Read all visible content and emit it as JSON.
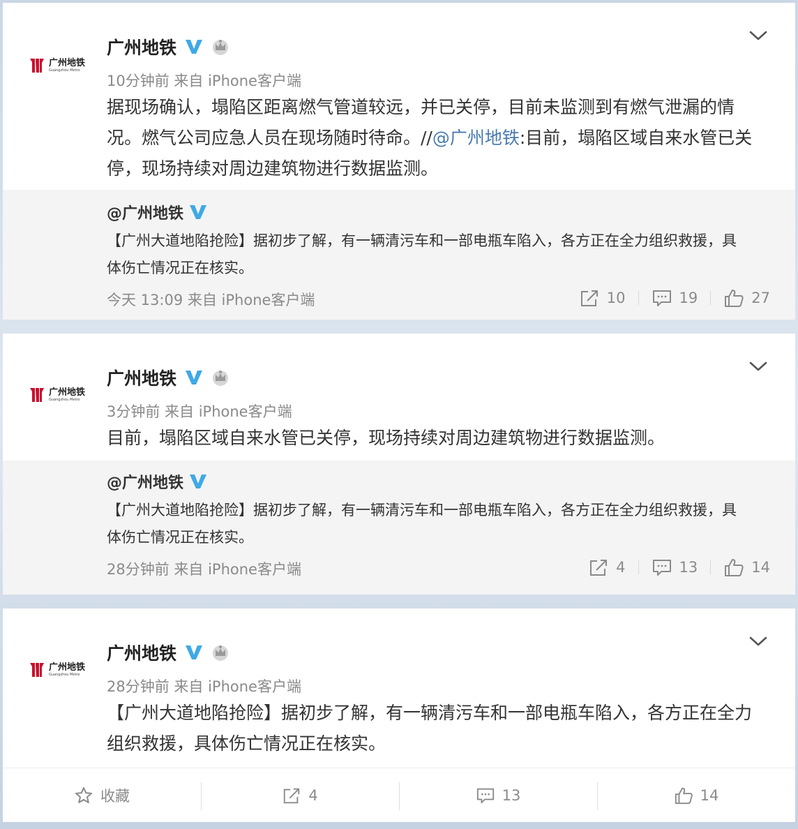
{
  "posts": [
    {
      "username": "广州地铁",
      "meta": "10分钟前 来自 iPhone客户端",
      "text_main": "据现场确认，塌陷区距离燃气管道较远，并已关停，目前未监测到有燃气泄漏的情况。燃气公司应急人员在现场随时待命。//",
      "mention": "@广州地铁",
      "text_tail": ":目前，塌陷区域自来水管已关停，现场持续对周边建筑物进行数据监测。",
      "quote": {
        "name": "@广州地铁",
        "text": "【广州大道地陷抢险】据初步了解，有一辆清污车和一部电瓶车陷入，各方正在全力组织救援，具体伤亡情况正在核实。",
        "meta": "今天 13:09 来自 iPhone客户端",
        "reposts": "10",
        "comments": "19",
        "likes": "27"
      }
    },
    {
      "username": "广州地铁",
      "meta": "3分钟前 来自 iPhone客户端",
      "text": "目前，塌陷区域自来水管已关停，现场持续对周边建筑物进行数据监测。",
      "quote": {
        "name": "@广州地铁",
        "text": "【广州大道地陷抢险】据初步了解，有一辆清污车和一部电瓶车陷入，各方正在全力组织救援，具体伤亡情况正在核实。",
        "meta": "28分钟前 来自 iPhone客户端",
        "reposts": "4",
        "comments": "13",
        "likes": "14"
      }
    },
    {
      "username": "广州地铁",
      "meta": "28分钟前 来自 iPhone客户端",
      "text": "【广州大道地陷抢险】据初步了解，有一辆清污车和一部电瓶车陷入，各方正在全力组织救援，具体伤亡情况正在核实。",
      "actions": {
        "favorite": "收藏",
        "reposts": "4",
        "comments": "13",
        "likes": "14"
      }
    }
  ],
  "logo": {
    "text_cn": "广州地铁",
    "text_en": "Guangzhou Metro"
  },
  "colors": {
    "brand_red": "#c8102e",
    "verified_blue": "#3fa9e6",
    "link": "#4a7bb0"
  }
}
